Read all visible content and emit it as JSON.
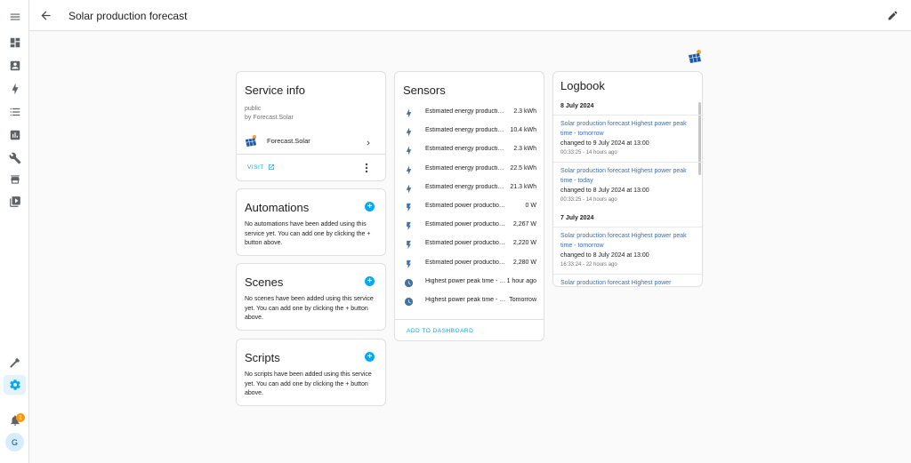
{
  "header": {
    "title": "Solar production forecast"
  },
  "service_info": {
    "title": "Service info",
    "visibility": "public",
    "by": "by Forecast.Solar",
    "integration": "Forecast.Solar",
    "visit_label": "VISIT"
  },
  "automations": {
    "title": "Automations",
    "desc": "No automations have been added using this service yet. You can add one by clicking the + button above."
  },
  "scenes": {
    "title": "Scenes",
    "desc": "No scenes have been added using this service yet. You can add one by clicking the + button above."
  },
  "scripts": {
    "title": "Scripts",
    "desc": "No scripts have been added using this service yet. You can add one by clicking the + button above."
  },
  "sensors": {
    "title": "Sensors",
    "items": [
      {
        "name": "Estimated energy production - this hour",
        "value": "2.3 kWh",
        "icon": "lightning-icon"
      },
      {
        "name": "Estimated energy production - today",
        "value": "10.4 kWh",
        "icon": "lightning-icon"
      },
      {
        "name": "Estimated energy production - next hour",
        "value": "2.3 kWh",
        "icon": "lightning-icon"
      },
      {
        "name": "Estimated energy production - remaining today",
        "value": "22.5 kWh",
        "icon": "lightning-icon"
      },
      {
        "name": "Estimated energy production - tomorrow",
        "value": "21.3 kWh",
        "icon": "lightning-icon"
      },
      {
        "name": "Estimated power production - now",
        "value": "0 W",
        "icon": "power-icon"
      },
      {
        "name": "Estimated power production - next hour",
        "value": "2,267 W",
        "icon": "power-icon"
      },
      {
        "name": "Estimated power production - next 12 hours",
        "value": "2,220 W",
        "icon": "power-icon"
      },
      {
        "name": "Estimated power production - next 24 hours",
        "value": "2,280 W",
        "icon": "power-icon"
      },
      {
        "name": "Highest power peak time - today",
        "value": "1 hour ago",
        "icon": "clock-icon"
      },
      {
        "name": "Highest power peak time - tomorrow",
        "value": "Tomorrow",
        "icon": "clock-icon"
      }
    ],
    "add_to_dashboard": "ADD TO DASHBOARD"
  },
  "logbook": {
    "title": "Logbook",
    "groups": [
      {
        "date": "8 July 2024",
        "entries": [
          {
            "title": "Solar production forecast Highest power peak time - tomorrow",
            "change": "changed to 9 July 2024 at 13:00",
            "time": "00:33:25 - 14 hours ago"
          },
          {
            "title": "Solar production forecast Highest power peak time - today",
            "change": "changed to 8 July 2024 at 13:00",
            "time": "00:33:25 - 14 hours ago"
          }
        ]
      },
      {
        "date": "7 July 2024",
        "entries": [
          {
            "title": "Solar production forecast Highest power peak time - tomorrow",
            "change": "changed to 8 July 2024 at 13:00",
            "time": "16:33:24 - 22 hours ago"
          },
          {
            "title": "Solar production forecast Highest power",
            "change": "",
            "time": ""
          }
        ]
      }
    ]
  },
  "sidebar": {
    "notification_count": "1",
    "user_initial": "G"
  },
  "colors": {
    "accent": "#03a9f4",
    "icon_blue": "#44739e",
    "badge": "#ff9800"
  }
}
